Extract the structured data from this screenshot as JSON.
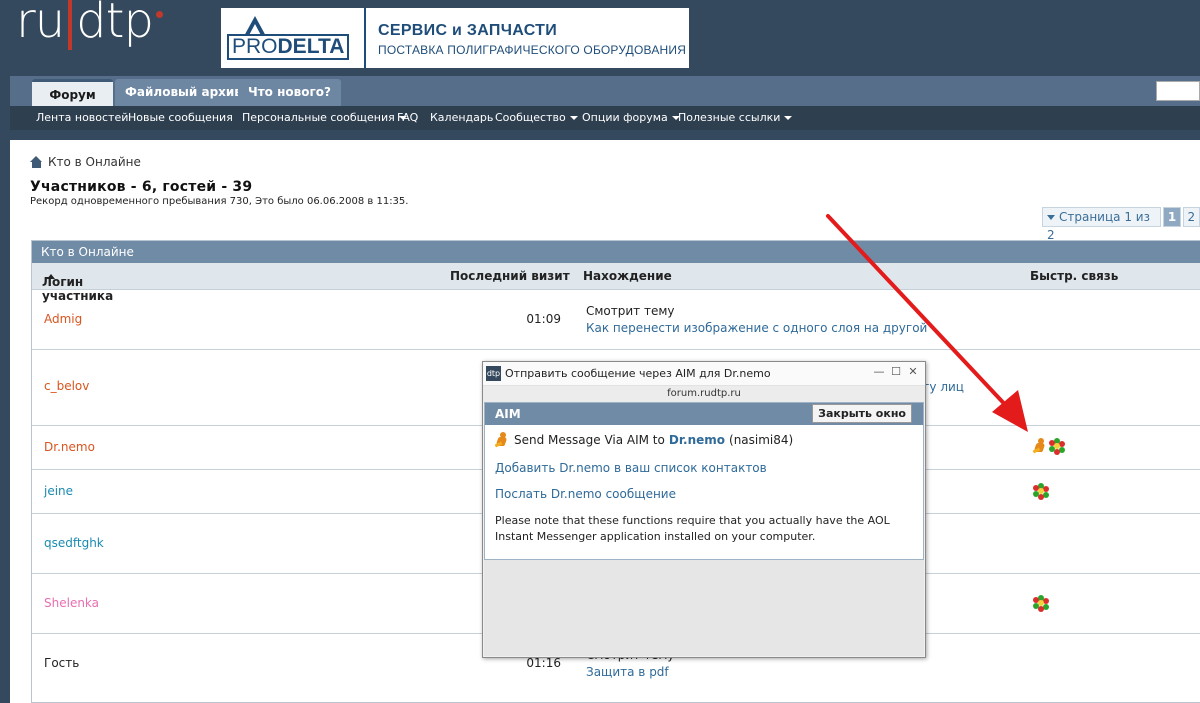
{
  "header": {
    "logo": {
      "part1": "ru",
      "part2": "dtp"
    },
    "banner": {
      "brand_light": "PRO",
      "brand_bold": "DELTA",
      "title": "СЕРВИС и ЗАПЧАСТИ",
      "subtitle": "ПОСТАВКА ПОЛИГРАФИЧЕСКОГО ОБОРУДОВАНИЯ"
    }
  },
  "nav": {
    "tabs": [
      {
        "label": "Форум",
        "active": true
      },
      {
        "label": "Файловый архив",
        "active": false
      },
      {
        "label": "Что нового?",
        "active": false
      }
    ],
    "sub": [
      "Лента новостей",
      "Новые сообщения",
      "Персональные сообщения",
      "FAQ",
      "Календарь",
      "Сообщество",
      "Опции форума",
      "Полезные ссылки"
    ]
  },
  "page": {
    "breadcrumb": "Кто в Онлайне",
    "title": "Участников - 6, гостей - 39",
    "record": "Рекорд одновременного пребывания 730, Это было 06.06.2008 в 11:35.",
    "pager": {
      "info": "Страница 1 из 2",
      "pages": [
        "1",
        "2"
      ],
      "current": "1"
    }
  },
  "block": {
    "title": "Кто в Онлайне",
    "columns": {
      "login": "Логин участника",
      "last_visit": "Последний визит",
      "location": "Нахождение",
      "quick": "Быстр. связь"
    },
    "rows": [
      {
        "name": "Admig",
        "color": "#d9541e",
        "time": "01:09",
        "loc_action": "Смотрит тему",
        "loc_link": "Как перенести изображение с одного слоя на другой"
      },
      {
        "name": "c_belov",
        "color": "#d9541e",
        "loc_partial": "угу лиц"
      },
      {
        "name": "Dr.nemo",
        "color": "#d9541e"
      },
      {
        "name": "jeine",
        "color": "#1a8ab0"
      },
      {
        "name": "qsedftghk",
        "color": "#1a8ab0"
      },
      {
        "name": "Shelenka",
        "color": "#e86fb0"
      },
      {
        "name": "Гость",
        "color": "#222222",
        "time": "01:16",
        "loc_action": "Смотрит тему",
        "loc_link": "Защита в pdf"
      }
    ]
  },
  "popup": {
    "window_title": "Отправить сообщение через AIM для Dr.nemo",
    "url": "forum.rudtp.ru",
    "controls": {
      "min": "—",
      "max": "☐",
      "close": "✕"
    },
    "header": "AIM",
    "close_button": "Закрыть окно",
    "send_prefix": "Send Message Via AIM to",
    "send_name": "Dr.nemo",
    "send_suffix": "(nasimi84)",
    "add_contact": "Добавить Dr.nemo в ваш список контактов",
    "send_msg": "Послать Dr.nemo сообщение",
    "note": "Please note that these functions require that you actually have the AOL Instant Messenger application installed on your computer."
  },
  "colors": {
    "header_bg": "#34495d",
    "accent_red": "#e41b1b",
    "link": "#2f6a99",
    "block_head": "#708ba6"
  }
}
